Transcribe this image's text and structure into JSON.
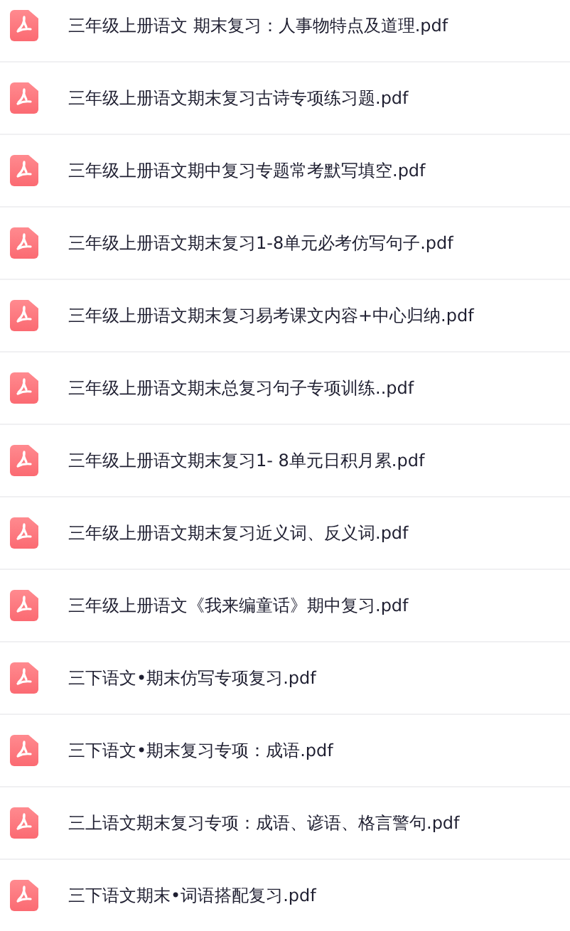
{
  "files": [
    {
      "name": "三年级上册语文 期末复习：人事物特点及道理.pdf"
    },
    {
      "name": "三年级上册语文期末复习古诗专项练习题.pdf"
    },
    {
      "name": "三年级上册语文期中复习专题常考默写填空.pdf"
    },
    {
      "name": "三年级上册语文期末复习1-8单元必考仿写句子.pdf"
    },
    {
      "name": "三年级上册语文期末复习易考课文内容+中心归纳.pdf"
    },
    {
      "name": "三年级上册语文期末总复习句子专项训练..pdf"
    },
    {
      "name": "三年级上册语文期末复习1- 8单元日积月累.pdf"
    },
    {
      "name": "三年级上册语文期末复习近义词、反义词.pdf"
    },
    {
      "name": "三年级上册语文《我来编童话》期中复习.pdf"
    },
    {
      "name": "三下语文•期末仿写专项复习.pdf"
    },
    {
      "name": "三下语文•期末复习专项：成语.pdf"
    },
    {
      "name": "三上语文期末复习专项：成语、谚语、格言警句.pdf"
    },
    {
      "name": "三下语文期末•词语搭配复习.pdf"
    }
  ]
}
